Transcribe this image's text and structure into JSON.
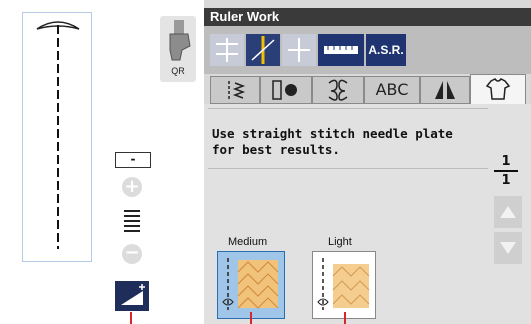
{
  "left_panel": {
    "foot_label": "QR",
    "value_display": "-",
    "plus_symbol": "+",
    "minus_symbol": "−"
  },
  "title": "Ruler Work",
  "toolbar": {
    "asr_label": "A.S.R."
  },
  "tabs": [
    {
      "name": "utility-stitch-tab-icon"
    },
    {
      "name": "buttonhole-tab-icon"
    },
    {
      "name": "decorative-stitch-tab-icon"
    },
    {
      "label": "ABC"
    },
    {
      "name": "quilt-tab-icon"
    },
    {
      "name": "garment-tab-icon"
    }
  ],
  "message": "Use straight stitch needle plate for best results.",
  "page": {
    "current": "1",
    "total": "1"
  },
  "choices": {
    "medium_label": "Medium",
    "light_label": "Light"
  },
  "colors": {
    "title_bar": "#3a3a3a",
    "selected_tool": "#1f3470",
    "selected_choice": "#9fc6e8",
    "indicator": "#d9262b"
  }
}
